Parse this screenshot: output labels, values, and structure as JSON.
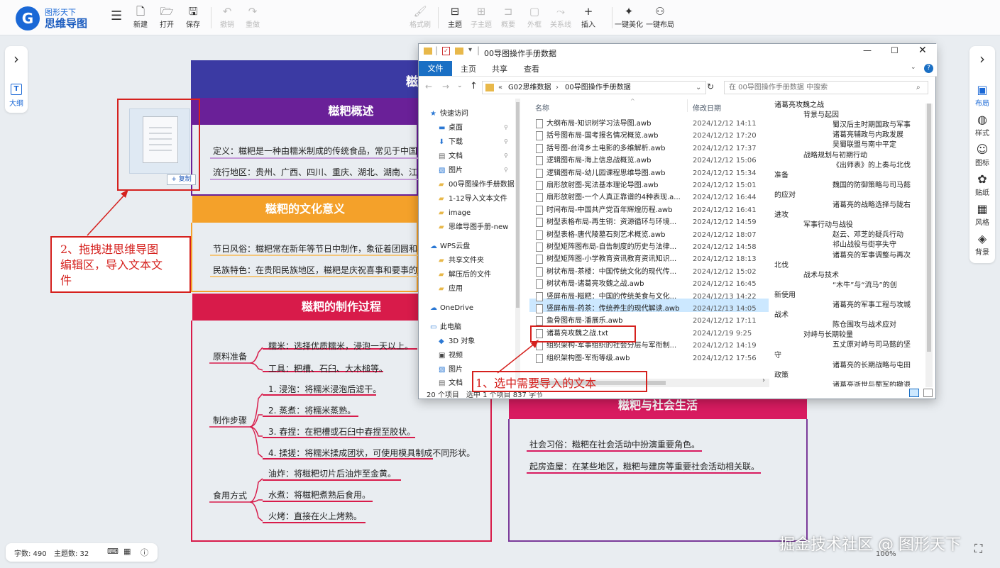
{
  "app": {
    "logo_letter": "G",
    "logo_sub": "图形天下",
    "logo_main": "思维导图"
  },
  "toolbar": [
    {
      "name": "new",
      "label": "新建",
      "icon": "new-file-icon",
      "glyph": "🗋"
    },
    {
      "name": "open",
      "label": "打开",
      "icon": "folder-open-icon",
      "glyph": "🗁"
    },
    {
      "name": "save",
      "label": "保存",
      "icon": "save-icon",
      "glyph": "🖫"
    },
    {
      "name": "undo",
      "label": "撤销",
      "icon": "undo-icon",
      "glyph": "↶"
    },
    {
      "name": "redo",
      "label": "重做",
      "icon": "redo-icon",
      "glyph": "↷"
    },
    {
      "name": "format-painter",
      "label": "格式刷",
      "icon": "format-painter-icon",
      "glyph": "🖌"
    },
    {
      "name": "topic",
      "label": "主题",
      "icon": "topic-icon",
      "glyph": "⊟"
    },
    {
      "name": "subtopic",
      "label": "子主题",
      "icon": "subtopic-icon",
      "glyph": "⊞"
    },
    {
      "name": "summary",
      "label": "概要",
      "icon": "summary-icon",
      "glyph": "⊐"
    },
    {
      "name": "frame",
      "label": "外框",
      "icon": "frame-icon",
      "glyph": "▢"
    },
    {
      "name": "relation",
      "label": "关系线",
      "icon": "relation-line-icon",
      "glyph": "⤳"
    },
    {
      "name": "insert",
      "label": "插入",
      "icon": "plus-icon",
      "glyph": "+"
    },
    {
      "name": "beautify",
      "label": "一键美化",
      "icon": "magic-wand-icon",
      "glyph": "✦"
    },
    {
      "name": "layout",
      "label": "一键布局",
      "icon": "layout-icon",
      "glyph": "⚇"
    }
  ],
  "left_panel": {
    "outline_label": "大纲",
    "outline_glyph": "T",
    "collapse_glyph": "›"
  },
  "right_panel": {
    "collapse_glyph": "›",
    "items": [
      {
        "label": "布局",
        "icon": "layout-panel-icon",
        "glyph": "▣"
      },
      {
        "label": "样式",
        "icon": "palette-icon",
        "glyph": "◍"
      },
      {
        "label": "图标",
        "icon": "smiley-icon",
        "glyph": "☺"
      },
      {
        "label": "贴纸",
        "icon": "sticker-icon",
        "glyph": "✿"
      },
      {
        "label": "风格",
        "icon": "grid-style-icon",
        "glyph": "▦"
      },
      {
        "label": "背景",
        "icon": "layers-icon",
        "glyph": "◈"
      }
    ]
  },
  "mindmap": {
    "root_partial": "糍",
    "sec1": {
      "title": "糍粑概述",
      "nodes": [
        "定义：糍粑是一种由糯米制成的传统食品，常见于中国南",
        "流行地区：贵州、广西、四川、重庆、湖北、湖南、江西"
      ]
    },
    "sec2": {
      "title": "糍粑的文化意义",
      "nodes": [
        "节日风俗：糍粑常在新年等节日中制作，象征着团圆和丰",
        "民族特色：在贵阳民族地区，糍粑是庆祝喜事和要事的重"
      ]
    },
    "sec3": {
      "title": "糍粑的制作过程",
      "groups": [
        {
          "label": "原料准备",
          "items": [
            "糯米：选择优质糯米，浸泡一天以上。",
            "工具：粑槽、石臼、大木槌等。"
          ]
        },
        {
          "label": "制作步骤",
          "items": [
            "1. 浸泡：将糯米浸泡后滤干。",
            "2. 蒸煮：将糯米蒸熟。",
            "3. 舂捏：在粑槽或石臼中舂捏至胶状。",
            "4. 揉搓：将糯米揉成团状，可使用模具制成不同形状。"
          ]
        },
        {
          "label": "食用方式",
          "items": [
            "油炸：将糍粑切片后油炸至金黄。",
            "水煮：将糍粑煮熟后食用。",
            "火烤：直接在火上烤熟。"
          ]
        }
      ]
    },
    "sec4": {
      "title": "糍粑与社会生活",
      "nodes": [
        "社会习俗：糍粑在社会活动中扮演重要角色。",
        "起房造屋：在某些地区，糍粑与建房等重要社会活动相关联。"
      ]
    }
  },
  "drag": {
    "copy_label": "+ 复制"
  },
  "annotations": {
    "step2_lines": [
      "2、拖拽进思维导图",
      "编辑区，导入文本文",
      "件"
    ],
    "step1": "1、选中需要导入的文本"
  },
  "explorer": {
    "title": "00导图操作手册数据",
    "ribbon": {
      "file": "文件",
      "home": "主页",
      "share": "共享",
      "view": "查看"
    },
    "address": [
      "G02思维数据",
      "00导图操作手册数据"
    ],
    "address_prefix": "«",
    "search_placeholder": "在 00导图操作手册数据 中搜索",
    "col_name": "名称",
    "col_date": "修改日期",
    "nav": [
      {
        "label": "快速访问",
        "glyph": "★",
        "color": "#2b78d4"
      },
      {
        "label": "桌面",
        "glyph": "▬",
        "color": "#2b78d4"
      },
      {
        "label": "下载",
        "glyph": "⬇",
        "color": "#2b78d4"
      },
      {
        "label": "文档",
        "glyph": "▤",
        "color": "#666"
      },
      {
        "label": "图片",
        "glyph": "▧",
        "color": "#2b78d4"
      },
      {
        "label": "00导图操作手册数据",
        "glyph": "▰",
        "color": "#e8b84a"
      },
      {
        "label": "1-12导入文本文件",
        "glyph": "▰",
        "color": "#e8b84a"
      },
      {
        "label": "image",
        "glyph": "▰",
        "color": "#e8b84a"
      },
      {
        "label": "思维导图手册-new",
        "glyph": "▰",
        "color": "#e8b84a"
      },
      {
        "label": "WPS云盘",
        "glyph": "☁",
        "color": "#2b78d4"
      },
      {
        "label": "共享文件夹",
        "glyph": "▰",
        "color": "#e8b84a"
      },
      {
        "label": "解压后的文件",
        "glyph": "▰",
        "color": "#e8b84a"
      },
      {
        "label": "应用",
        "glyph": "▰",
        "color": "#e8b84a"
      },
      {
        "label": "OneDrive",
        "glyph": "☁",
        "color": "#2b78d4"
      },
      {
        "label": "此电脑",
        "glyph": "▭",
        "color": "#2b78d4"
      },
      {
        "label": "3D 对象",
        "glyph": "◆",
        "color": "#2b78d4"
      },
      {
        "label": "视频",
        "glyph": "▣",
        "color": "#444"
      },
      {
        "label": "图片",
        "glyph": "▧",
        "color": "#2b78d4"
      },
      {
        "label": "文档",
        "glyph": "▤",
        "color": "#666"
      }
    ],
    "files": [
      [
        "大纲布局-知识树学习法导图.awb",
        "2024/12/12 14:11"
      ],
      [
        "括号图布局-国考报名情况概览.awb",
        "2024/12/12 17:20"
      ],
      [
        "括号图-台湾乡土电影的多维解析.awb",
        "2024/12/12 17:37"
      ],
      [
        "逻辑图布局-海上信息战概览.awb",
        "2024/12/12 15:06"
      ],
      [
        "逻辑图布局-幼儿园课程思维导图.awb",
        "2024/12/12 15:34"
      ],
      [
        "扇形放射图-宪法基本理论导图.awb",
        "2024/12/12 15:01"
      ],
      [
        "扇形放射图-一个人真正靠谱的4种表现.a...",
        "2024/12/12 16:44"
      ],
      [
        "时间布局-中国共产党百年辉煌历程.awb",
        "2024/12/12 16:41"
      ],
      [
        "树型表格布局-再生铜：资源循环与环境...",
        "2024/12/12 14:59"
      ],
      [
        "树型表格-唐代陵墓石刻艺术概览.awb",
        "2024/12/12 18:07"
      ],
      [
        "树型矩阵图布局-自告制度的历史与法律...",
        "2024/12/12 14:58"
      ],
      [
        "树型矩阵图-小学教育资讯教育资讯知识...",
        "2024/12/12 18:13"
      ],
      [
        "树状布局-茶楼：中国传统文化的现代传...",
        "2024/12/12 15:02"
      ],
      [
        "树状布局-诸葛亮攻魏之战.awb",
        "2024/12/12 16:45"
      ],
      [
        "竖屏布局-糍粑：中国的传统美食与文化...",
        "2024/12/13 14:22"
      ],
      [
        "竖屏布局-药茶：传统养生的现代解读.awb",
        "2024/12/13 14:05"
      ],
      [
        "鱼骨图布局-潘展乐.awb",
        "2024/12/12 17:11"
      ],
      [
        "诸葛亮攻魏之战.txt",
        "2024/12/19 9:25"
      ],
      [
        "组织架构-军事组织的社会分层与军衔制...",
        "2024/12/12 14:19"
      ],
      [
        "组织架构图-军衔等级.awb",
        "2024/12/12 17:56"
      ]
    ],
    "status": "20 个项目　选中 1 个项目  837 字节",
    "preview": [
      {
        "t": "诸葛亮攻魏之战",
        "i": 0
      },
      {
        "t": "背景与起因",
        "i": 1
      },
      {
        "t": "蜀汉后主时期国政与军事",
        "i": 2
      },
      {
        "t": "诸葛亮辅政与内政发展",
        "i": 2
      },
      {
        "t": "吴蜀联盟与南中平定",
        "i": 2
      },
      {
        "t": "战略规划与初期行动",
        "i": 1
      },
      {
        "t": "《出师表》的上奏与北伐",
        "i": 2
      },
      {
        "t": "准备",
        "i": 0
      },
      {
        "t": "魏国的防御策略与司马懿",
        "i": 2
      },
      {
        "t": "的应对",
        "i": 0
      },
      {
        "t": "诸葛亮的战略选择与陇右",
        "i": 2
      },
      {
        "t": "进攻",
        "i": 0
      },
      {
        "t": "军事行动与战役",
        "i": 1
      },
      {
        "t": "赵云、邓芝的疑兵行动",
        "i": 2
      },
      {
        "t": "祁山战役与街亭失守",
        "i": 2
      },
      {
        "t": "诸葛亮的军事调整与再次",
        "i": 2
      },
      {
        "t": "北伐",
        "i": 0
      },
      {
        "t": "战术与技术",
        "i": 1
      },
      {
        "t": "“木牛”与“流马”的创",
        "i": 2
      },
      {
        "t": "新使用",
        "i": 0
      },
      {
        "t": "诸葛亮的军事工程与攻城",
        "i": 2
      },
      {
        "t": "战术",
        "i": 0
      },
      {
        "t": "陈仓围攻与战术应对",
        "i": 2
      },
      {
        "t": "对峙与长期较量",
        "i": 1
      },
      {
        "t": "五丈原对峙与司马懿的坚",
        "i": 2
      },
      {
        "t": "守",
        "i": 0
      },
      {
        "t": "诸葛亮的长期战略与屯田",
        "i": 2
      },
      {
        "t": "政策",
        "i": 0
      },
      {
        "t": "诸葛亮逝世与蜀军的撤退",
        "i": 2
      }
    ]
  },
  "statusbar": {
    "word_count": "字数: 490",
    "topic_count": "主题数: 32",
    "zoom": "100%"
  },
  "watermark": "掘金技术社区 @ 图形天下",
  "colors": {
    "brand": "#1a68d6",
    "root": "#3b3aa3",
    "sec1": "#6a1b9a",
    "sec2": "#f39c1f",
    "sec3": "#d81b4a",
    "sec4": "#d81b60",
    "annot": "#d5211e",
    "select": "#cce8ff"
  }
}
